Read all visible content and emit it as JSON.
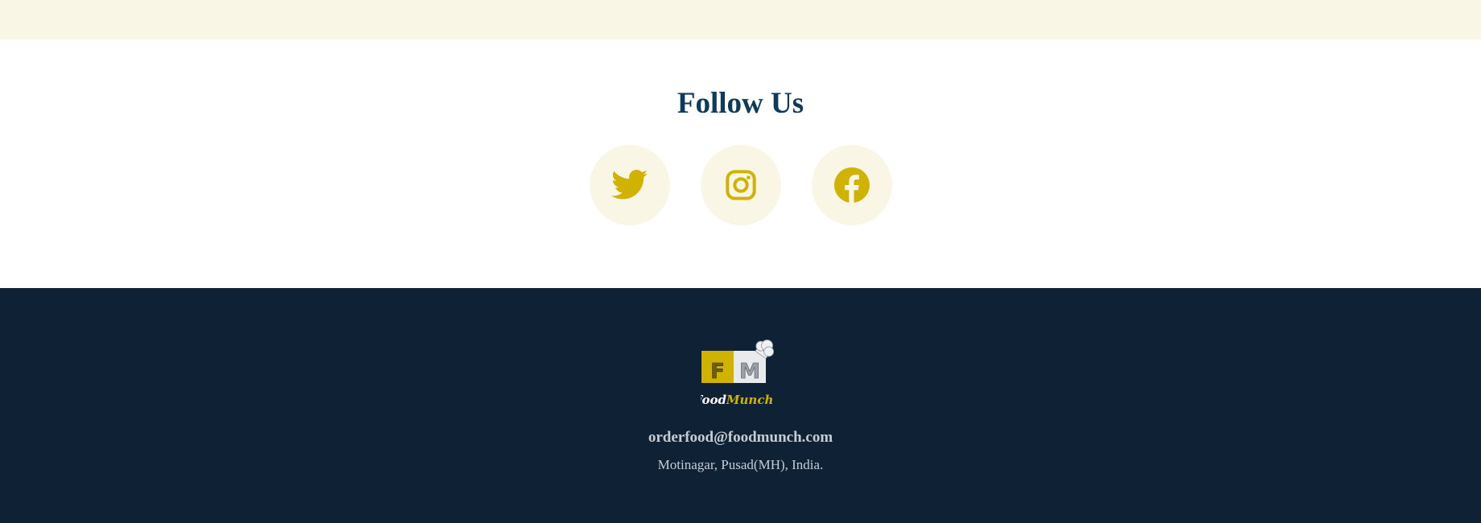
{
  "follow": {
    "title": "Follow Us",
    "social": [
      {
        "name": "twitter",
        "icon": "twitter-icon"
      },
      {
        "name": "instagram",
        "icon": "instagram-icon"
      },
      {
        "name": "facebook",
        "icon": "facebook-icon"
      }
    ]
  },
  "footer": {
    "logo": {
      "letters": [
        "F",
        "M"
      ],
      "brand_part1": "Food",
      "brand_part2": "Munch",
      "icon": "chef-hat-icon"
    },
    "email": "orderfood@foodmunch.com",
    "address": "Motinagar, Pusad(MH), India."
  },
  "colors": {
    "accent": "#d0b200",
    "cream": "#faf6e5",
    "heading": "#0f3b5a",
    "footer_bg": "#0f2235",
    "footer_text": "#c7ccd3"
  }
}
